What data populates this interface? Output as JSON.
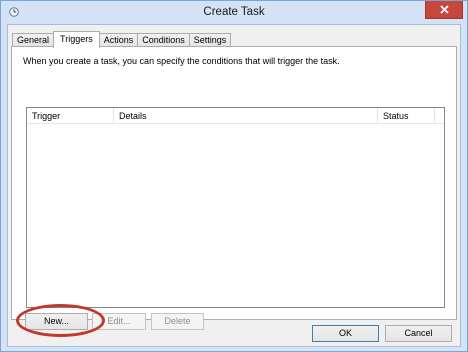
{
  "window": {
    "title": "Create Task",
    "app_icon": "task-scheduler-clock-icon",
    "close_icon": "close-icon"
  },
  "tabs": [
    {
      "label": "General",
      "active": false
    },
    {
      "label": "Triggers",
      "active": true
    },
    {
      "label": "Actions",
      "active": false
    },
    {
      "label": "Conditions",
      "active": false
    },
    {
      "label": "Settings",
      "active": false
    }
  ],
  "triggers_panel": {
    "description": "When you create a task, you can specify the conditions that will trigger the task.",
    "columns": [
      "Trigger",
      "Details",
      "Status"
    ],
    "rows": []
  },
  "buttons": {
    "new": "New...",
    "edit": "Edit...",
    "delete": "Delete",
    "ok": "OK",
    "cancel": "Cancel"
  },
  "annotation": {
    "color": "#c1392b",
    "highlighted": "New..."
  },
  "colors": {
    "close_button": "#c7463e",
    "frame": "#d3e2f5"
  }
}
